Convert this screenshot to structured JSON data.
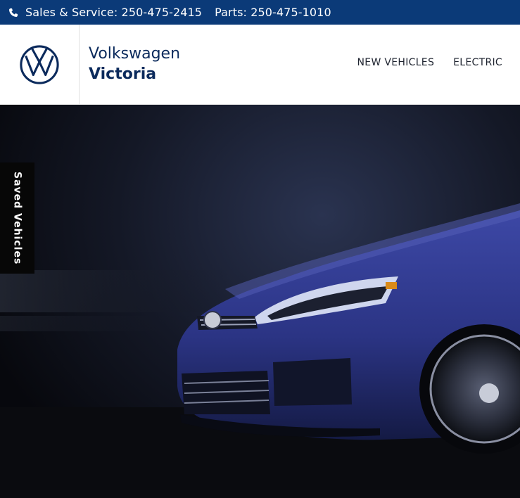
{
  "topbar": {
    "phone_icon": "phone-icon",
    "sales_text": "Sales & Service: 250-475-2415",
    "parts_text": "Parts: 250-475-1010"
  },
  "header": {
    "logo_icon": "vw-logo-icon",
    "brand_line1": "Volkswagen",
    "brand_line2": "Victoria",
    "nav": [
      {
        "label": "NEW VEHICLES"
      },
      {
        "label": "ELECTRIC"
      }
    ]
  },
  "sidebar_tab": {
    "label": "Saved Vehicles"
  },
  "colors": {
    "topbar_bg": "#0b3a78",
    "brand_text": "#0b2a5c",
    "hero_bg": "#0b0d14",
    "car_body": "#2b3484"
  }
}
